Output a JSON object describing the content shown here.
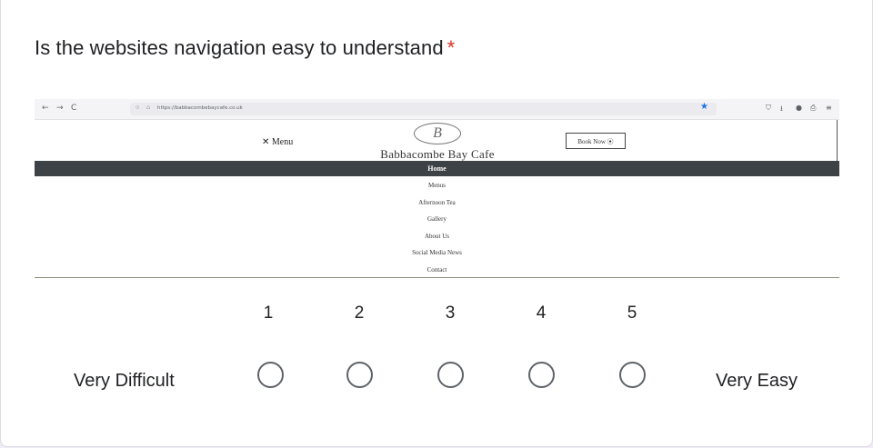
{
  "question": {
    "title": "Is the websites navigation easy to understand",
    "required_mark": "*"
  },
  "screenshot": {
    "browser": {
      "back_icon": "←",
      "forward_icon": "→",
      "reload_icon": "C",
      "url": "https://babbacombebaycafe.co.uk",
      "bookmark_star": "★",
      "toolbar_icons": [
        "⛉",
        "⭳",
        "●",
        "⎙",
        "≡"
      ]
    },
    "site": {
      "menu_toggle": "✕ Menu",
      "logo_letter": "B",
      "logo_text": "Babbacombe Bay Cafe",
      "book_button": "Book Now ⦿",
      "nav_active": "Home",
      "nav_items": [
        "Menus",
        "Afternoon Tea",
        "Gallery",
        "About Us",
        "Social Media News",
        "Contact"
      ]
    }
  },
  "scale": {
    "numbers": [
      "1",
      "2",
      "3",
      "4",
      "5"
    ],
    "low_label": "Very Difficult",
    "high_label": "Very Easy",
    "selected": null
  }
}
